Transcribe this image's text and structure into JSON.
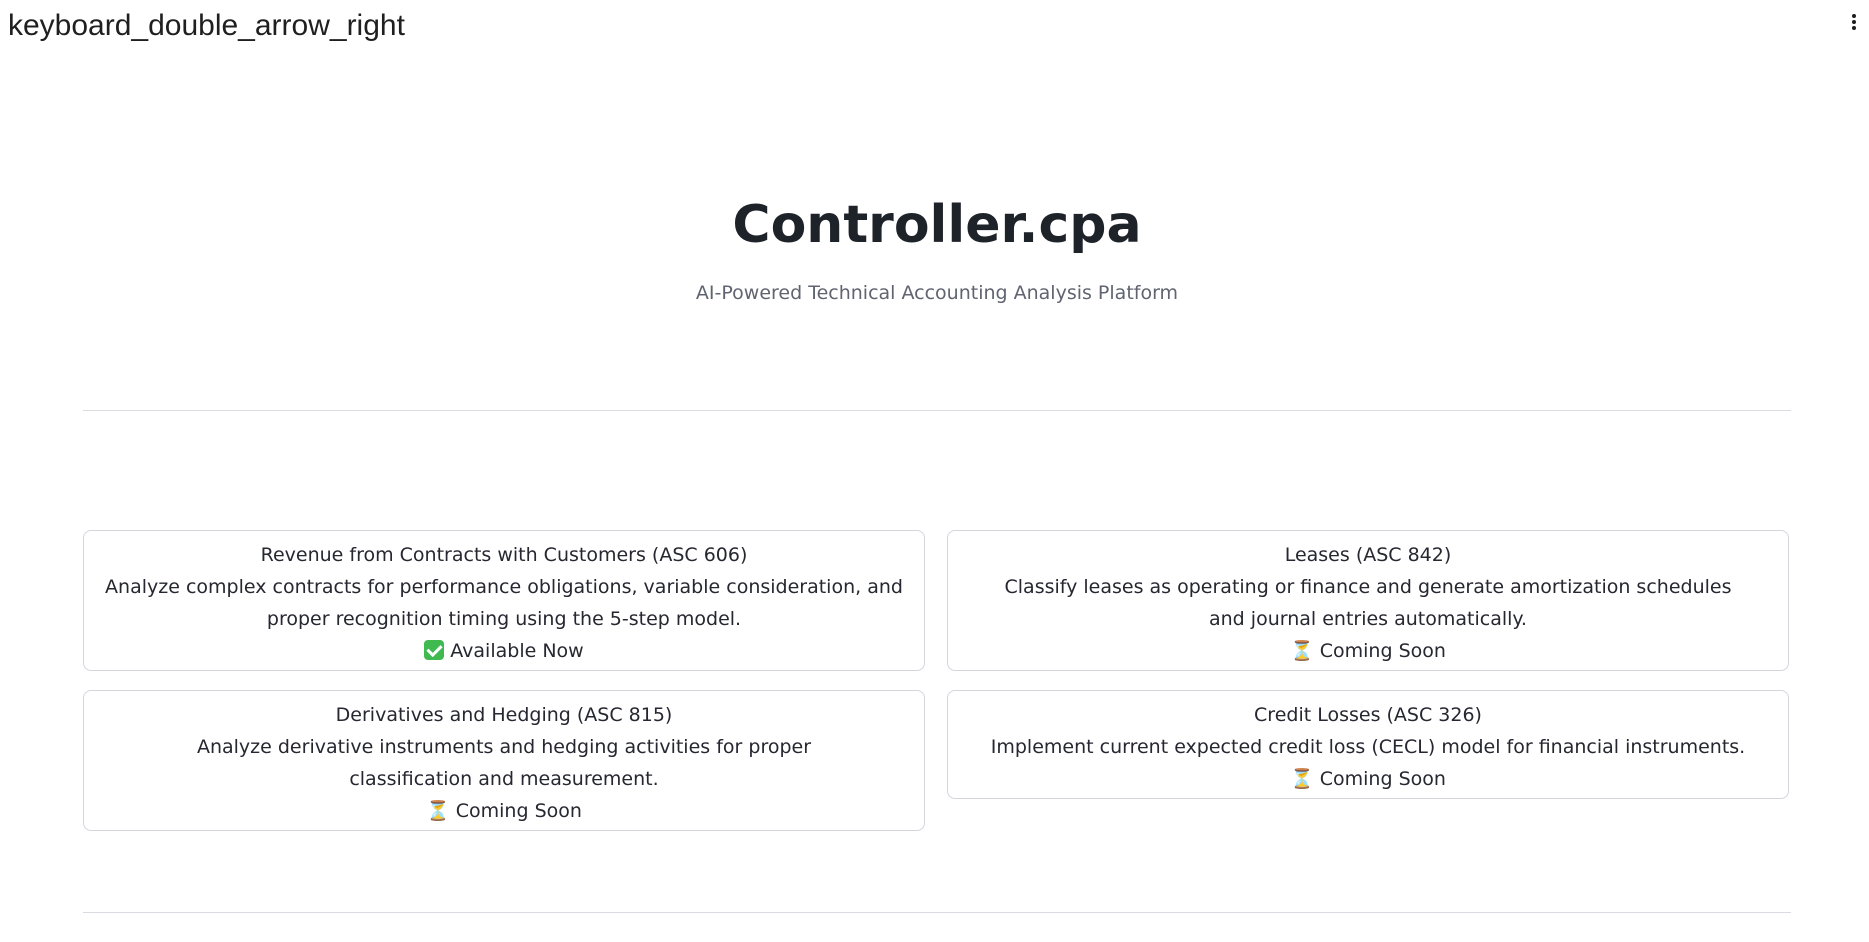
{
  "header": {
    "sidebar_toggle_label": "keyboard_double_arrow_right",
    "menu_icon": "kebab-vertical-icon"
  },
  "hero": {
    "title": "Controller.cpa",
    "subtitle": "AI-Powered Technical Accounting Analysis Platform"
  },
  "modules": [
    {
      "title": "Revenue from Contracts with Customers (ASC 606)",
      "description": "Analyze complex contracts for performance obligations, variable consideration, and proper recognition timing using the 5-step model.",
      "status": "Available Now",
      "status_icon": "check-box-icon"
    },
    {
      "title": "Leases (ASC 842)",
      "description": "Classify leases as operating or finance and generate amortization schedules and journal entries automatically.",
      "status": "Coming Soon",
      "status_icon": "hourglass-icon"
    },
    {
      "title": "Derivatives and Hedging (ASC 815)",
      "description": "Analyze derivative instruments and hedging activities for proper classification and measurement.",
      "status": "Coming Soon",
      "status_icon": "hourglass-icon"
    },
    {
      "title": "Credit Losses (ASC 326)",
      "description": "Implement current expected credit loss (CECL) model for financial instruments.",
      "status": "Coming Soon",
      "status_icon": "hourglass-icon"
    }
  ],
  "colors": {
    "available_badge": "#3fb950",
    "title_text": "#1e2229",
    "subtitle_text": "#5f6470",
    "card_border": "#d2d5da"
  }
}
